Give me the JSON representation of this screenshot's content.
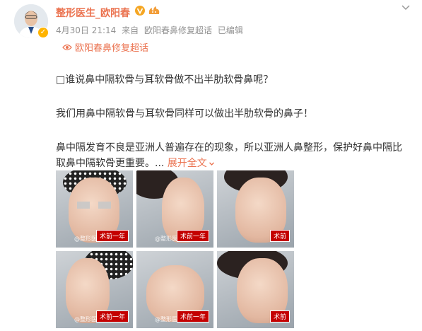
{
  "author": {
    "name": "整形医生_欧阳春"
  },
  "meta": {
    "date": "4月30日 21:14",
    "source_prefix": "来自",
    "source": "欧阳春鼻修复超话",
    "edited": "已编辑"
  },
  "topic": {
    "label": "欧阳春鼻修复超话"
  },
  "post": {
    "line1": "□谁说鼻中隔软骨与耳软骨做不出半肋软骨鼻呢？",
    "line2": "我们用鼻中隔软骨与耳软骨同样可以做出半肋软骨的鼻子！",
    "line3": "鼻中隔发育不良是亚洲人普遍存在的现象，所以亚洲人鼻整形，保护好鼻中隔比取鼻中隔软骨更重要。...",
    "more": "展开全文"
  },
  "photos": [
    {
      "label": "术前一年",
      "watermark": "@整形医生_欧阳春",
      "view": "front"
    },
    {
      "label": "术前一年",
      "watermark": "@整形医生",
      "view": "profile-right"
    },
    {
      "label": "术前",
      "watermark": "",
      "view": "three-quarter"
    },
    {
      "label": "术前一年",
      "watermark": "@整形医生_欧阳春",
      "view": "profile-left"
    },
    {
      "label": "术前一年",
      "watermark": "@整形医生_欧阳春",
      "view": "base"
    },
    {
      "label": "术前",
      "watermark": "",
      "view": "three-quarter-2"
    }
  ],
  "colors": {
    "accent": "#eb7350",
    "meta": "#939393",
    "text": "#333333"
  },
  "icons": [
    "chevron-down-icon",
    "verified-icon",
    "fan-badge-icon",
    "supertopic-icon",
    "expand-arrow-icon"
  ]
}
